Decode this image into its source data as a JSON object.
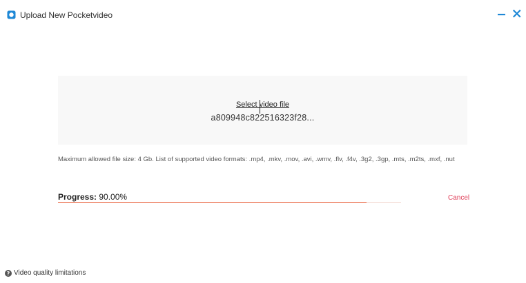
{
  "window": {
    "title": "Upload New Pocketvideo",
    "app_icon": "app-logo-icon",
    "minimize_icon": "minimize-icon",
    "close_icon": "close-icon",
    "accent_color": "#1e88d6"
  },
  "upload": {
    "select_label": "Select video file",
    "filename": "a809948c822516323f28..."
  },
  "info_text": "Maximum allowed file size: 4 Gb. List of supported video formats: .mp4, .mkv, .mov, .avi, .wmv, .flv, .f4v, .3g2, .3gp, .mts, .m2ts, .mxf, .nut",
  "progress": {
    "label": "Progress:",
    "value_text": "90.00%",
    "value": 0.9,
    "bar_color": "#e8542c"
  },
  "cancel_label": "Cancel",
  "cancel_color": "#e0405a",
  "footer": {
    "help_icon": "question-circle-icon",
    "quality_link": "Video quality limitations"
  }
}
